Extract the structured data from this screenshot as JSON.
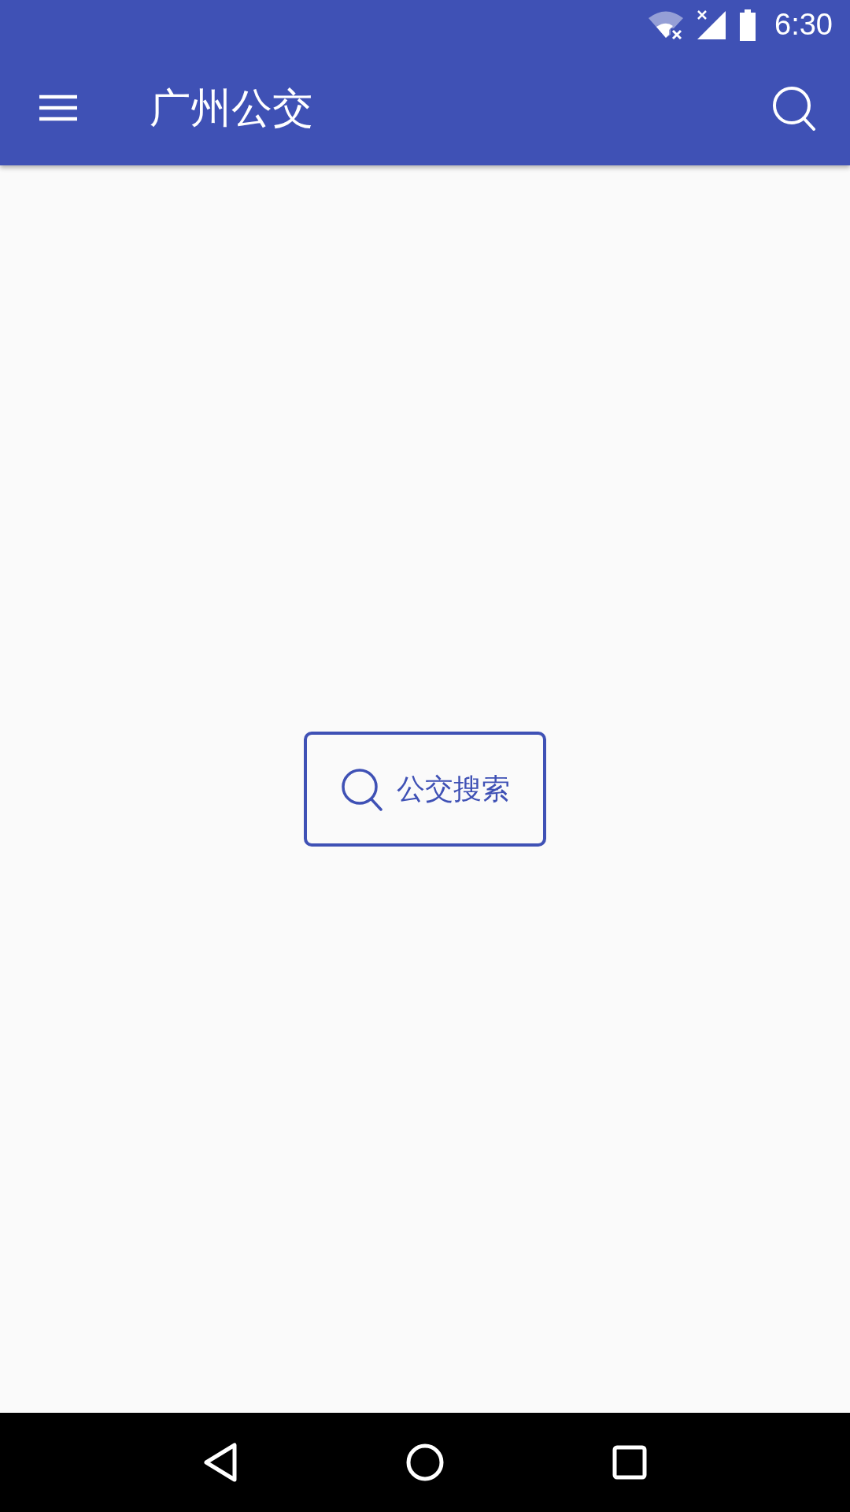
{
  "status_bar": {
    "time": "6:30"
  },
  "app_bar": {
    "title": "广州公交"
  },
  "search_button": {
    "label": "公交搜索"
  }
}
